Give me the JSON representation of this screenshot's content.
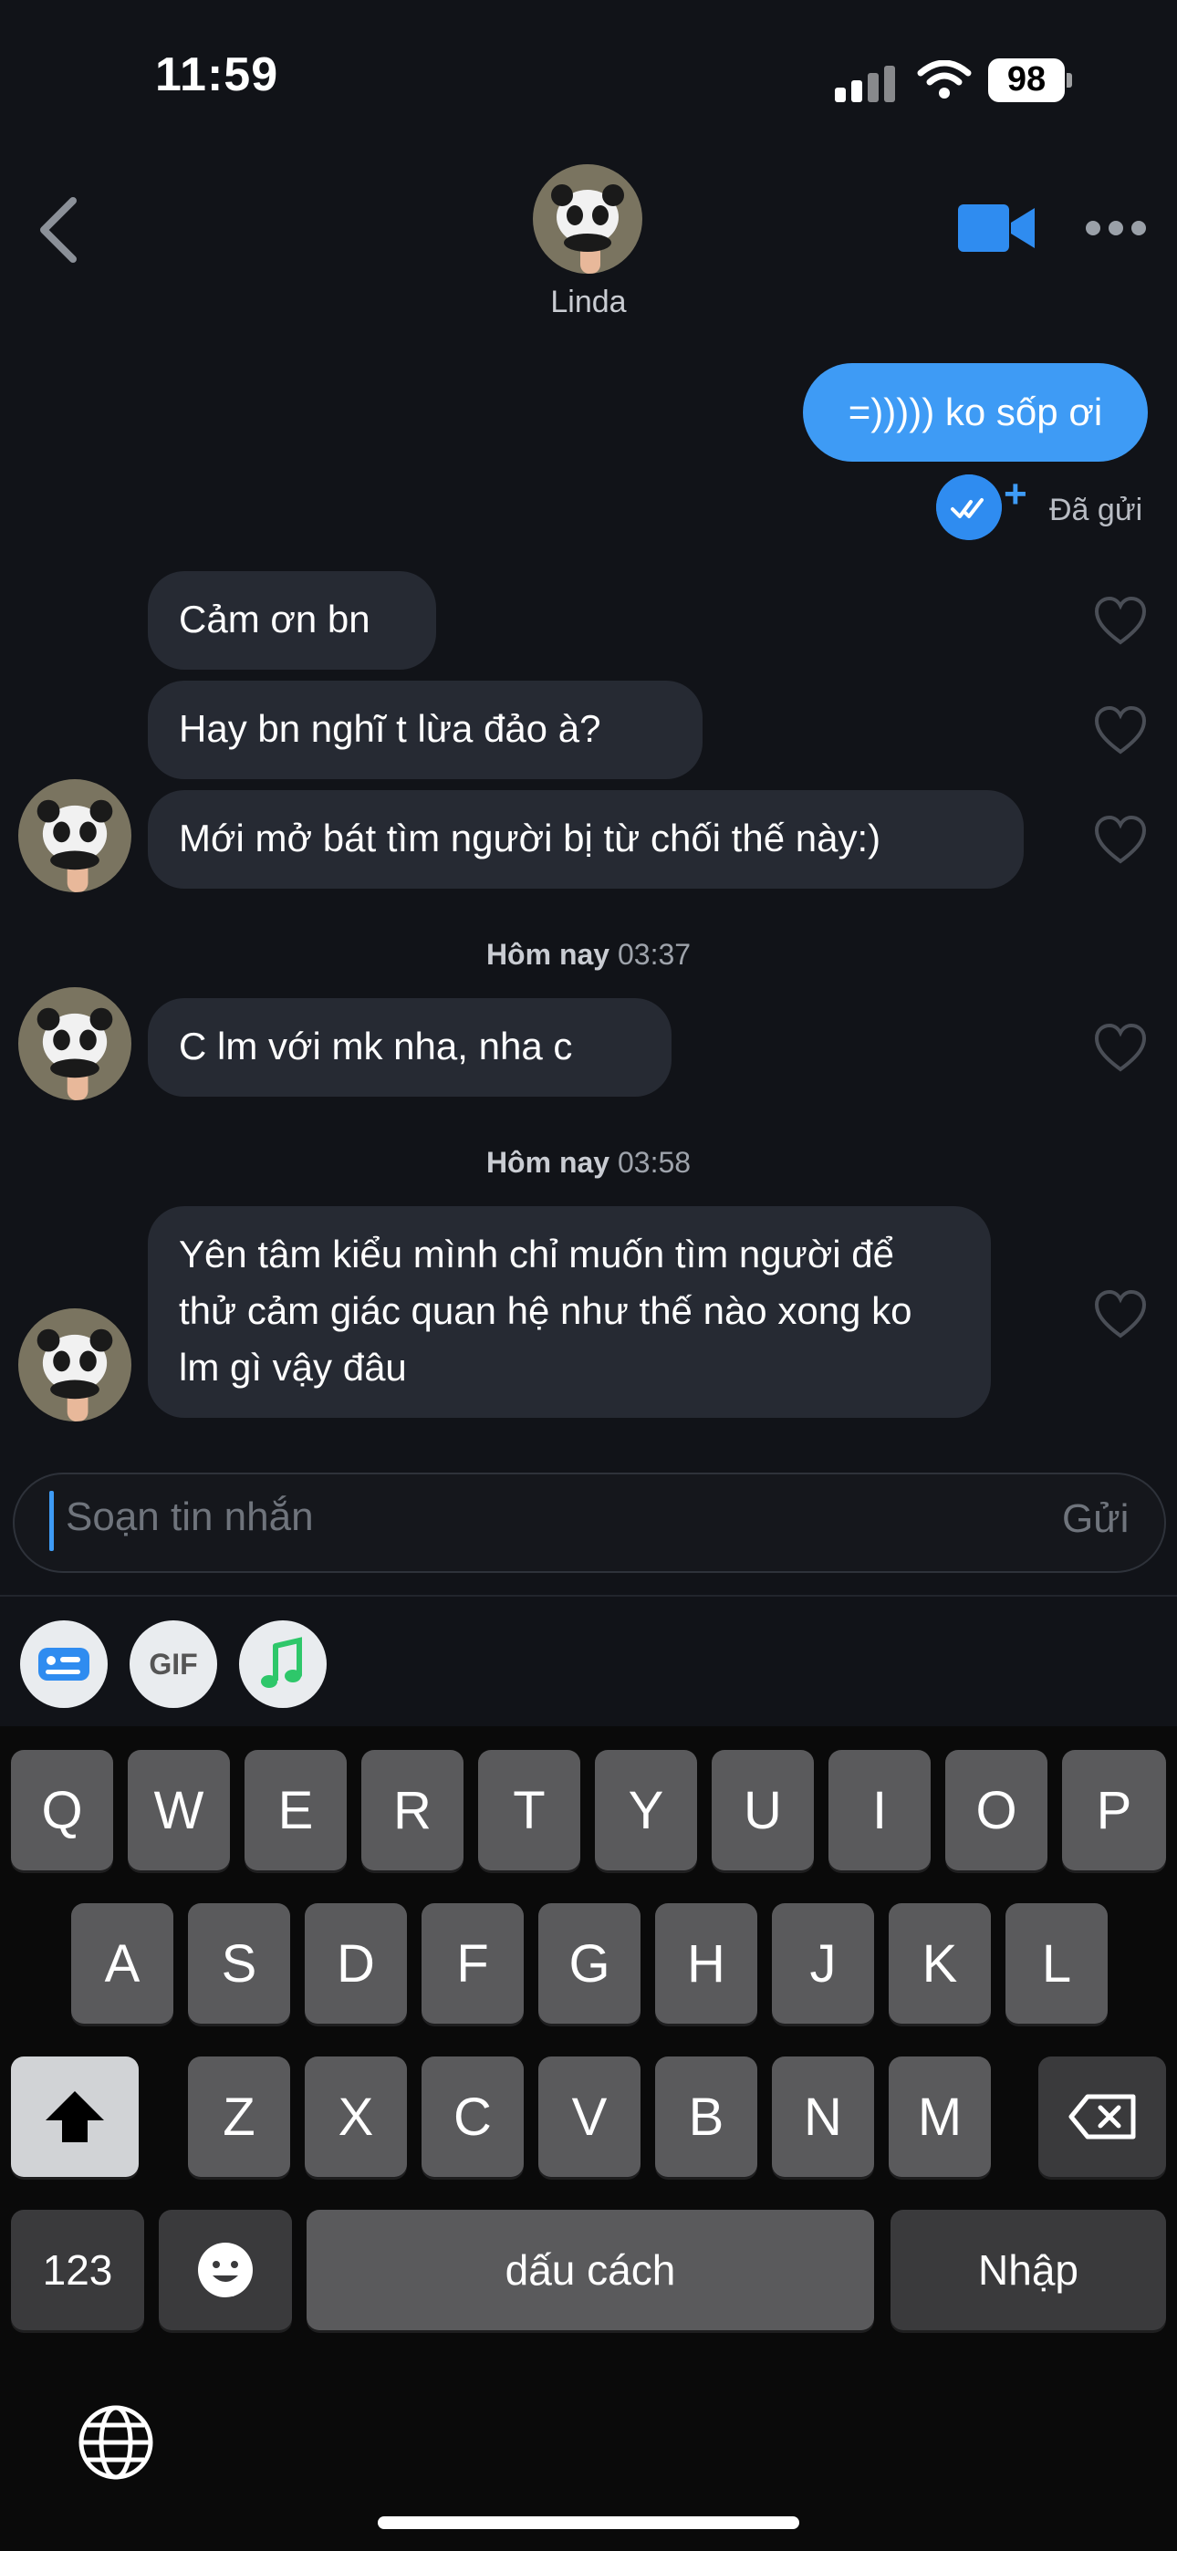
{
  "status_bar": {
    "time": "11:59",
    "battery": "98"
  },
  "header": {
    "contact_name": "Linda"
  },
  "messages": {
    "outgoing": {
      "text": "=))))) ko sốp ơi",
      "status": "Đã gửi"
    },
    "group1": [
      "Cảm ơn bn",
      "Hay bn nghĩ t lừa đảo à?",
      "Mới mở bát tìm người bị từ chối thế này:)"
    ],
    "ts1": {
      "label": "Hôm nay",
      "time": "03:37"
    },
    "msg4": "C lm với mk nha, nha c",
    "ts2": {
      "label": "Hôm nay",
      "time": "03:58"
    },
    "msg5": "Yên tâm kiểu mình chỉ muốn tìm người để thử cảm giác quan hệ như thế nào xong ko lm gì vậy đâu"
  },
  "composer": {
    "placeholder": "Soạn tin nhắn",
    "send_label": "Gửi"
  },
  "attachments": {
    "gif_label": "GIF"
  },
  "keyboard": {
    "row1": [
      "Q",
      "W",
      "E",
      "R",
      "T",
      "Y",
      "U",
      "I",
      "O",
      "P"
    ],
    "row2": [
      "A",
      "S",
      "D",
      "F",
      "G",
      "H",
      "J",
      "K",
      "L"
    ],
    "row3": [
      "Z",
      "X",
      "C",
      "V",
      "B",
      "N",
      "M"
    ],
    "numbers_label": "123",
    "space_label": "dấu cách",
    "return_label": "Nhập"
  },
  "colors": {
    "accent": "#3e9bf5",
    "background": "#111318",
    "bubble_in": "#262a33"
  }
}
